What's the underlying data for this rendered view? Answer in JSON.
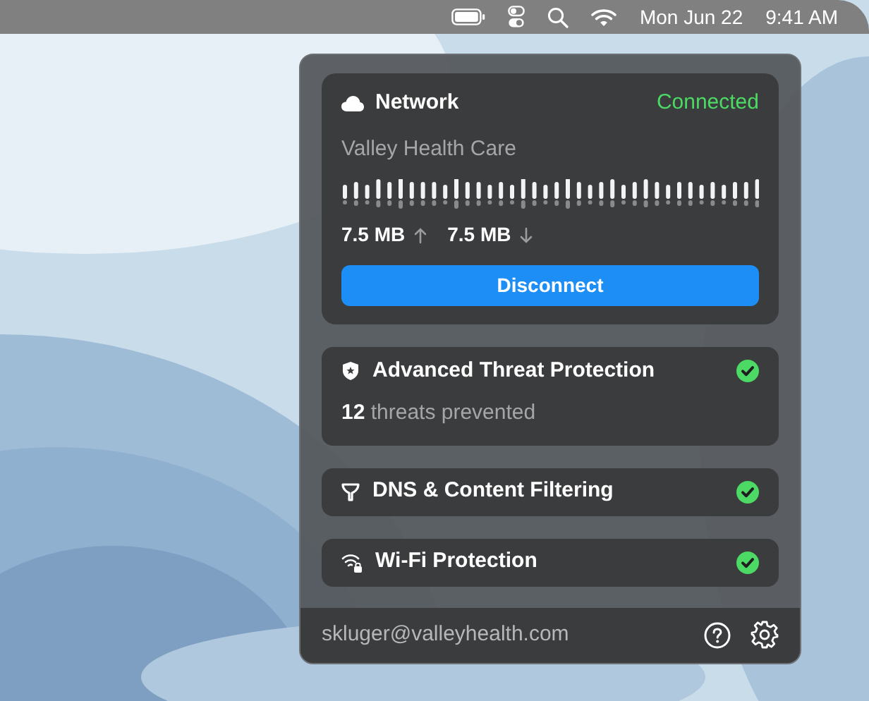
{
  "menu_bar": {
    "date": "Mon Jun 22",
    "time": "9:41 AM"
  },
  "network": {
    "title": "Network",
    "status": "Connected",
    "connected": true,
    "name": "Valley Health Care",
    "upload": "7.5 MB",
    "download": "7.5 MB",
    "button": "Disconnect"
  },
  "features": [
    {
      "kind": "shield",
      "title": "Advanced Threat Protection",
      "detail": "**12** threats prevented",
      "enabled": true
    },
    {
      "kind": "filter",
      "title": "DNS & Content Filtering",
      "enabled": true
    },
    {
      "kind": "wifi",
      "title": "Wi-Fi Protection",
      "enabled": true
    }
  ],
  "footer": {
    "email": "skluger@valleyhealth.com"
  }
}
